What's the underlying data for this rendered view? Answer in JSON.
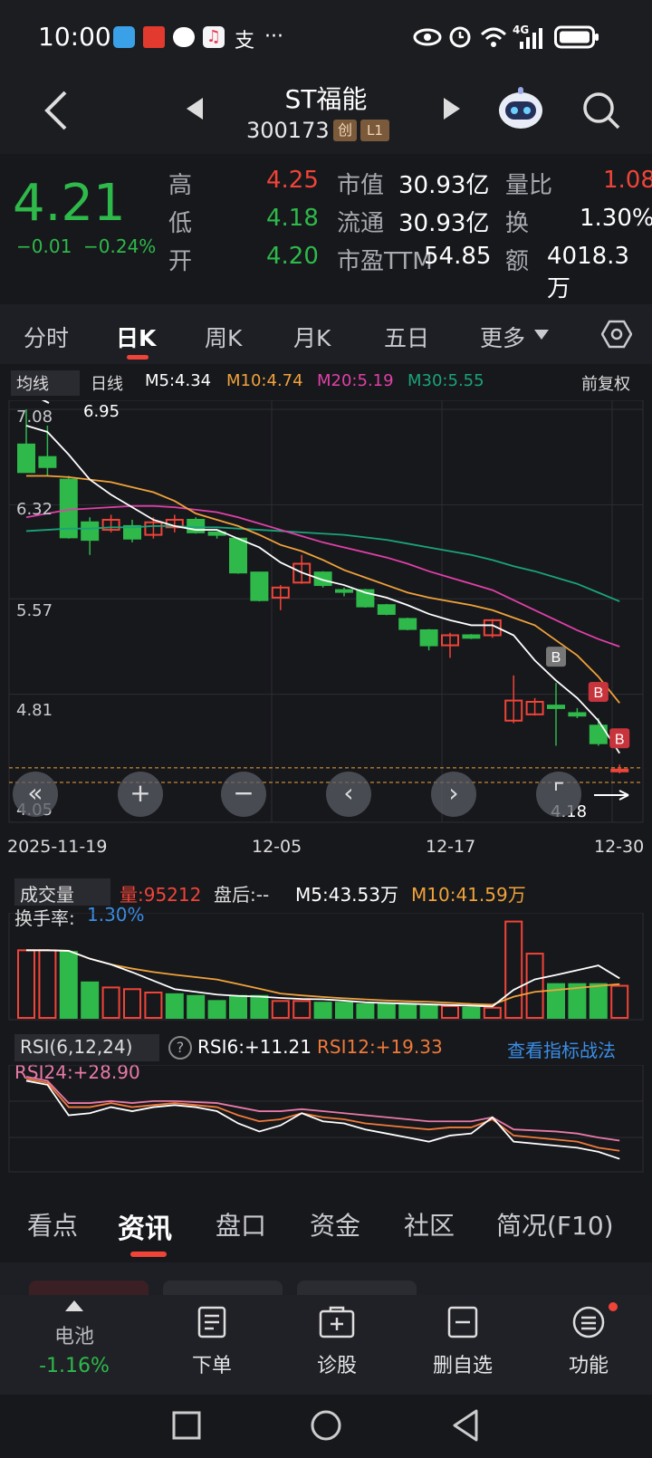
{
  "status_bar": {
    "time": "10:00",
    "more": "···",
    "network": "4G"
  },
  "header": {
    "stock_name": "ST福能",
    "stock_code": "300173",
    "badge_chuang": "创",
    "badge_level": "L1"
  },
  "quote": {
    "price": "4.21",
    "change": "−0.01",
    "change_pct": "−0.24%",
    "high_label": "高",
    "high": "4.25",
    "low_label": "低",
    "low": "4.18",
    "open_label": "开",
    "open": "4.20",
    "mktcap_label": "市值",
    "mktcap": "30.93亿",
    "float_label": "流通",
    "float": "30.93亿",
    "pe_label": "市盈TTM",
    "pe": "54.85",
    "volratio_label": "量比",
    "volratio": "1.08",
    "turnover_label": "换",
    "turnover": "1.30%",
    "amount_label": "额",
    "amount": "4018.3万"
  },
  "tabs": [
    "分时",
    "日K",
    "周K",
    "月K",
    "五日",
    "更多"
  ],
  "indicator_bar": {
    "ma_selector": "均线",
    "period": "日线",
    "m5": "M5:4.34",
    "m10": "M10:4.74",
    "m20": "M20:5.19",
    "m30": "M30:5.55",
    "adjust": "前复权"
  },
  "price_chart": {
    "y_labels": [
      "7.08",
      "6.32",
      "5.57",
      "4.81",
      "4.05"
    ],
    "max_marker": "6.95",
    "min_marker": "4.18",
    "x_labels": [
      "2025-11-19",
      "12-05",
      "12-17",
      "12-30"
    ],
    "buy_marker": "B"
  },
  "volume_panel": {
    "selector": "成交量",
    "vol": "量:95212",
    "after_hours": "盘后:--",
    "m5": "M5:43.53万",
    "m10": "M10:41.59万",
    "turnover": "换手率:",
    "turnover_value": "1.30%"
  },
  "rsi_panel": {
    "selector": "RSI(6,12,24)",
    "rsi6": "RSI6:+11.21",
    "rsi12": "RSI12:+19.33",
    "rsi24": "RSI24:+28.90",
    "strategy_link": "查看指标战法"
  },
  "info_tabs": [
    "看点",
    "资讯",
    "盘口",
    "资金",
    "社区",
    "简况(F10)"
  ],
  "bottom_nav": {
    "sector_name": "电池",
    "sector_change": "-1.16%",
    "order": "下单",
    "diagnose": "诊股",
    "remove_watch": "删自选",
    "functions": "功能"
  },
  "colors": {
    "up": "#f04438",
    "down": "#2eb94a",
    "m5": "#ffffff",
    "m10": "#f0a23a",
    "m20": "#e040a8",
    "m30": "#1aa37a",
    "link": "#3a8ee6"
  },
  "chart_data": {
    "type": "candlestick",
    "candles": [
      {
        "o": 6.8,
        "c": 6.58,
        "h": 7.08,
        "l": 6.58
      },
      {
        "o": 6.7,
        "c": 6.62,
        "h": 6.95,
        "l": 6.55
      },
      {
        "o": 6.52,
        "c": 6.06,
        "h": 6.55,
        "l": 6.05
      },
      {
        "o": 6.18,
        "c": 6.04,
        "h": 6.22,
        "l": 5.92
      },
      {
        "o": 6.12,
        "c": 6.2,
        "h": 6.24,
        "l": 6.1
      },
      {
        "o": 6.15,
        "c": 6.05,
        "h": 6.2,
        "l": 6.02
      },
      {
        "o": 6.08,
        "c": 6.18,
        "h": 6.22,
        "l": 6.05
      },
      {
        "o": 6.14,
        "c": 6.2,
        "h": 6.24,
        "l": 6.1
      },
      {
        "o": 6.2,
        "c": 6.1,
        "h": 6.22,
        "l": 6.09
      },
      {
        "o": 6.1,
        "c": 6.08,
        "h": 6.11,
        "l": 6.05
      },
      {
        "o": 6.05,
        "c": 5.78,
        "h": 6.06,
        "l": 5.77
      },
      {
        "o": 5.78,
        "c": 5.56,
        "h": 5.78,
        "l": 5.55
      },
      {
        "o": 5.58,
        "c": 5.66,
        "h": 5.68,
        "l": 5.48
      },
      {
        "o": 5.7,
        "c": 5.85,
        "h": 5.92,
        "l": 5.69
      },
      {
        "o": 5.78,
        "c": 5.68,
        "h": 5.79,
        "l": 5.66
      },
      {
        "o": 5.64,
        "c": 5.63,
        "h": 5.66,
        "l": 5.59
      },
      {
        "o": 5.64,
        "c": 5.51,
        "h": 5.65,
        "l": 5.5
      },
      {
        "o": 5.52,
        "c": 5.45,
        "h": 5.53,
        "l": 5.44
      },
      {
        "o": 5.41,
        "c": 5.33,
        "h": 5.42,
        "l": 5.32
      },
      {
        "o": 5.32,
        "c": 5.2,
        "h": 5.33,
        "l": 5.16
      },
      {
        "o": 5.2,
        "c": 5.28,
        "h": 5.3,
        "l": 5.1
      },
      {
        "o": 5.28,
        "c": 5.26,
        "h": 5.29,
        "l": 5.25
      },
      {
        "o": 5.28,
        "c": 5.4,
        "h": 5.41,
        "l": 5.26
      },
      {
        "o": 4.6,
        "c": 4.76,
        "h": 4.96,
        "l": 4.58
      },
      {
        "o": 4.65,
        "c": 4.75,
        "h": 4.78,
        "l": 4.64
      },
      {
        "o": 4.72,
        "c": 4.7,
        "h": 4.9,
        "l": 4.4
      },
      {
        "o": 4.66,
        "c": 4.64,
        "h": 4.7,
        "l": 4.62
      },
      {
        "o": 4.56,
        "c": 4.42,
        "h": 4.62,
        "l": 4.4
      },
      {
        "o": 4.2,
        "c": 4.21,
        "h": 4.25,
        "l": 4.18
      }
    ],
    "ma5": [
      6.95,
      6.9,
      6.72,
      6.52,
      6.4,
      6.3,
      6.2,
      6.15,
      6.12,
      6.12,
      6.05,
      5.98,
      5.86,
      5.78,
      5.72,
      5.68,
      5.62,
      5.58,
      5.52,
      5.45,
      5.4,
      5.36,
      5.36,
      5.28,
      5.08,
      4.92,
      4.78,
      4.6,
      4.34
    ],
    "ma10": [
      6.55,
      6.55,
      6.54,
      6.52,
      6.5,
      6.46,
      6.42,
      6.35,
      6.25,
      6.2,
      6.15,
      6.08,
      6.0,
      5.95,
      5.88,
      5.8,
      5.74,
      5.68,
      5.62,
      5.58,
      5.55,
      5.52,
      5.48,
      5.42,
      5.36,
      5.24,
      5.12,
      4.95,
      4.74
    ],
    "ma20": [
      6.22,
      6.25,
      6.28,
      6.29,
      6.3,
      6.31,
      6.31,
      6.3,
      6.28,
      6.26,
      6.22,
      6.17,
      6.12,
      6.07,
      6.02,
      5.98,
      5.94,
      5.9,
      5.85,
      5.79,
      5.74,
      5.69,
      5.64,
      5.56,
      5.48,
      5.4,
      5.32,
      5.25,
      5.19
    ],
    "ma30": [
      6.11,
      6.12,
      6.13,
      6.13,
      6.14,
      6.14,
      6.15,
      6.15,
      6.14,
      6.14,
      6.13,
      6.12,
      6.11,
      6.1,
      6.09,
      6.08,
      6.06,
      6.04,
      6.01,
      5.98,
      5.95,
      5.92,
      5.88,
      5.83,
      5.79,
      5.74,
      5.69,
      5.62,
      5.55
    ],
    "volume_up": [
      true,
      true,
      false,
      false,
      true,
      true,
      true,
      false,
      false,
      false,
      false,
      false,
      true,
      true,
      false,
      false,
      false,
      false,
      false,
      false,
      true,
      false,
      true,
      true,
      true,
      false,
      false,
      false,
      true
    ],
    "volume": [
      40,
      40,
      39,
      21,
      18,
      17,
      15,
      14,
      13,
      10,
      13,
      13,
      10,
      10,
      9,
      9,
      8,
      8,
      8,
      7,
      7,
      6,
      6,
      57,
      38,
      20,
      20,
      20,
      19
    ],
    "rsi6": [
      88,
      84,
      54,
      56,
      62,
      58,
      62,
      64,
      62,
      58,
      46,
      38,
      44,
      56,
      48,
      46,
      40,
      36,
      32,
      28,
      34,
      36,
      52,
      28,
      26,
      24,
      22,
      18,
      11
    ],
    "rsi12": [
      90,
      86,
      62,
      62,
      66,
      62,
      64,
      66,
      64,
      62,
      54,
      48,
      50,
      56,
      52,
      50,
      46,
      44,
      42,
      40,
      42,
      42,
      50,
      34,
      32,
      30,
      28,
      22,
      19
    ],
    "rsi24": [
      92,
      88,
      66,
      66,
      68,
      66,
      68,
      68,
      67,
      66,
      62,
      58,
      58,
      60,
      58,
      56,
      54,
      52,
      50,
      48,
      48,
      48,
      52,
      40,
      39,
      38,
      36,
      32,
      29
    ],
    "ylim": [
      4.05,
      7.08
    ]
  }
}
